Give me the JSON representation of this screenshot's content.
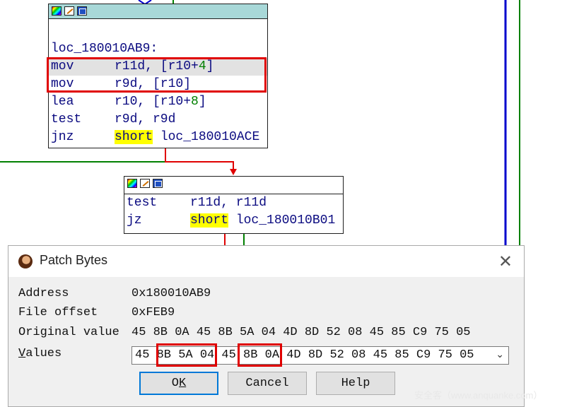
{
  "block1": {
    "label": "loc_180010AB9:",
    "lines": [
      {
        "mnemonic": "mov",
        "operands": "r11d, [r10+4]"
      },
      {
        "mnemonic": "mov",
        "operands": "r9d, [r10]"
      },
      {
        "mnemonic": "lea",
        "operands": "r10, [r10+8]"
      },
      {
        "mnemonic": "test",
        "operands": "r9d, r9d"
      },
      {
        "mnemonic": "jnz",
        "operands": "short loc_180010ACE"
      }
    ]
  },
  "block2": {
    "lines": [
      {
        "mnemonic": "test",
        "operands": "r11d, r11d"
      },
      {
        "mnemonic": "jz",
        "operands": "short loc_180010B01"
      }
    ]
  },
  "dialog": {
    "title": "Patch Bytes",
    "address_label": "Address",
    "address_value": "0x180010AB9",
    "file_offset_label": "File offset",
    "file_offset_value": "0xFEB9",
    "original_label": "Original value",
    "original_value": "45 8B 0A 45 8B 5A 04 4D 8D 52 08 45 85 C9 75 05",
    "values_label_underlined": "V",
    "values_label_rest": "alues",
    "values_value": "45 8B 5A 04 45 8B 0A 4D 8D 52 08 45 85 C9 75 05",
    "ok_underlined": "K",
    "ok_prefix": "O",
    "cancel_label": "Cancel",
    "help_label": "Help"
  },
  "watermark": "安全客（www.anquanke.com）",
  "colors": {
    "code_text": "#0a0a80",
    "number": "#008000",
    "highlight": "#ffff00",
    "title_bar": "#a8d8d8",
    "annotation_red": "#e00000",
    "edge_green": "#008000",
    "edge_blue": "#0000cc",
    "edge_red": "#e00000"
  }
}
